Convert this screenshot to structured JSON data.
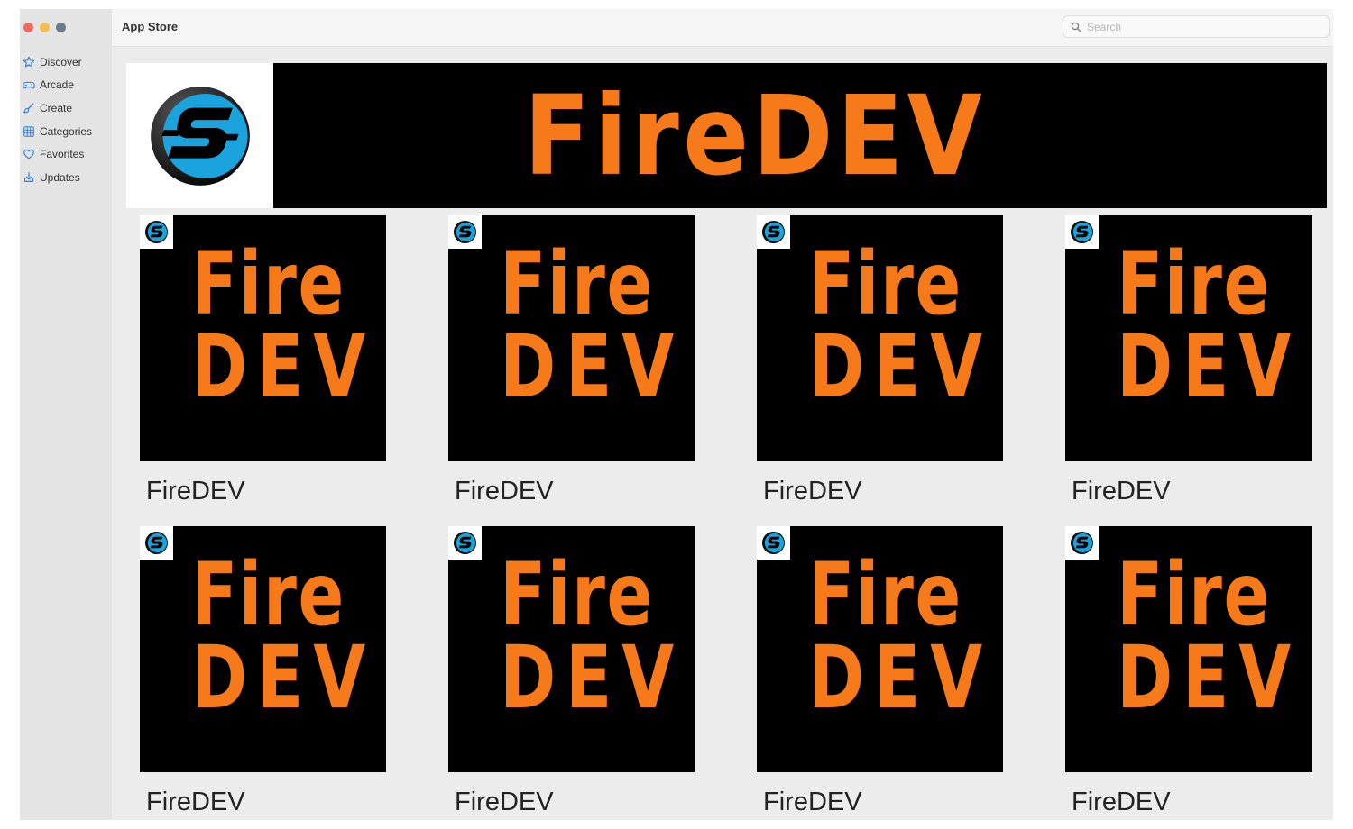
{
  "window": {
    "title": "App Store",
    "traffic_lights": [
      "close",
      "minimize",
      "zoom"
    ]
  },
  "sidebar": {
    "items": [
      {
        "label": "Discover",
        "icon": "star-icon"
      },
      {
        "label": "Arcade",
        "icon": "gamepad-icon"
      },
      {
        "label": "Create",
        "icon": "brush-icon"
      },
      {
        "label": "Categories",
        "icon": "grid-icon"
      },
      {
        "label": "Favorites",
        "icon": "heart-icon"
      },
      {
        "label": "Updates",
        "icon": "download-icon"
      }
    ]
  },
  "search": {
    "placeholder": "Search",
    "value": ""
  },
  "hero": {
    "title": "FireDEV",
    "logo": "s-logo-icon"
  },
  "apps": [
    {
      "name": "FireDEV",
      "thumb_line1": "Fire",
      "thumb_line2": "DEV"
    },
    {
      "name": "FireDEV",
      "thumb_line1": "Fire",
      "thumb_line2": "DEV"
    },
    {
      "name": "FireDEV",
      "thumb_line1": "Fire",
      "thumb_line2": "DEV"
    },
    {
      "name": "FireDEV",
      "thumb_line1": "Fire",
      "thumb_line2": "DEV"
    },
    {
      "name": "FireDEV",
      "thumb_line1": "Fire",
      "thumb_line2": "DEV"
    },
    {
      "name": "FireDEV",
      "thumb_line1": "Fire",
      "thumb_line2": "DEV"
    },
    {
      "name": "FireDEV",
      "thumb_line1": "Fire",
      "thumb_line2": "DEV"
    },
    {
      "name": "FireDEV",
      "thumb_line1": "Fire",
      "thumb_line2": "DEV"
    }
  ],
  "colors": {
    "accent": "#2c7be5",
    "brand_orange": "#f6791a",
    "logo_blue": "#1aa3dd"
  }
}
